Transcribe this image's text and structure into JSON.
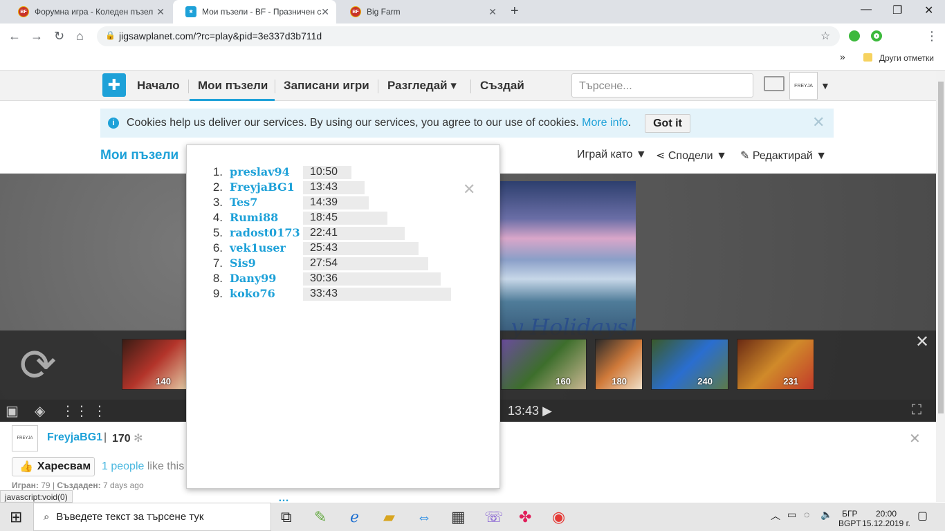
{
  "browser": {
    "tabs": [
      {
        "title": "Форумна игра - Коледен пъзел"
      },
      {
        "title": "Мои пъзели - BF - Празничен с"
      },
      {
        "title": "Big Farm"
      }
    ],
    "url": "jigsawplanet.com/?rc=play&pid=3e337d3b711d",
    "bookmarks_label": "Други отметки"
  },
  "site": {
    "nav": [
      "Начало",
      "Мои пъзели",
      "Записани игри",
      "Разгледай",
      "Създай"
    ],
    "search_placeholder": "Търсене...",
    "avatar_label": "FREYJA"
  },
  "cookie": {
    "text": "Cookies help us deliver our services. By using our services, you agree to our use of cookies.",
    "more": "More info",
    "button": "Got it"
  },
  "page": {
    "title": "Мои пъзели",
    "actions": [
      "Играй като",
      "Сподели",
      "Редактирай"
    ]
  },
  "puzzle": {
    "image_text": "y Holidays!",
    "thumbs": [
      {
        "pieces": "140",
        "colors": [
          "#3a1c14",
          "#b3342a",
          "#e2c9a4"
        ]
      },
      {
        "pieces": "160",
        "colors": [
          "#6a4c9c",
          "#3d6e2c",
          "#c9b691"
        ]
      },
      {
        "pieces": "180",
        "colors": [
          "#2a2a2a",
          "#d07a3a",
          "#f0e0c8"
        ]
      },
      {
        "pieces": "240",
        "colors": [
          "#3a5a2a",
          "#2a6ed0",
          "#5c7a4a"
        ]
      },
      {
        "pieces": "231",
        "colors": [
          "#6a2a14",
          "#d08a2a",
          "#c23a2a"
        ]
      }
    ],
    "timer": "13:43"
  },
  "owner": {
    "name": "FreyjaBG1",
    "points": "170",
    "like": "Харесвам",
    "like_count": "1 people",
    "like_suffix": "like this",
    "played_label": "Игран:",
    "played": "79",
    "created_label": "Създаден:",
    "created": "7 days ago"
  },
  "leaderboard": [
    {
      "rank": "1.",
      "name": "preslav94",
      "time": "10:50",
      "fraction": 0.329
    },
    {
      "rank": "2.",
      "name": "FreyjaBG1",
      "time": "13:43",
      "fraction": 0.416
    },
    {
      "rank": "3.",
      "name": "Tes7",
      "time": "14:39",
      "fraction": 0.444
    },
    {
      "rank": "4.",
      "name": "Rumi88",
      "time": "18:45",
      "fraction": 0.569
    },
    {
      "rank": "5.",
      "name": "radost0173",
      "time": "22:41",
      "fraction": 0.688
    },
    {
      "rank": "6.",
      "name": "vek1user",
      "time": "25:43",
      "fraction": 0.78
    },
    {
      "rank": "7.",
      "name": "Sis9",
      "time": "27:54",
      "fraction": 0.846
    },
    {
      "rank": "8.",
      "name": "Dany99",
      "time": "30:36",
      "fraction": 0.928
    },
    {
      "rank": "9.",
      "name": "koko76",
      "time": "33:43",
      "fraction": 1.0
    }
  ],
  "status_bar": "javascript:void(0)",
  "taskbar": {
    "search": "Въведете текст за търсене тук",
    "lang_top": "БГР",
    "lang_bottom": "BGPT",
    "time": "20:00",
    "date": "15.12.2019 г."
  }
}
